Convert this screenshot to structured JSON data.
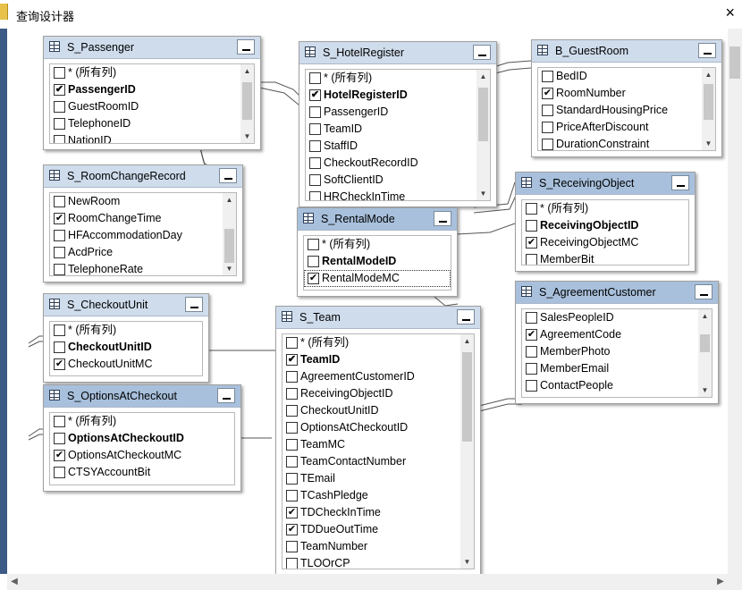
{
  "window": {
    "title": "查询设计器",
    "close_label": "×"
  },
  "tables": [
    {
      "id": "passenger",
      "title": "S_Passenger",
      "columns": [
        {
          "name": "* (所有列)",
          "checked": false,
          "pk": false
        },
        {
          "name": "PassengerID",
          "checked": true,
          "pk": true
        },
        {
          "name": "GuestRoomID",
          "checked": false,
          "pk": false
        },
        {
          "name": "TelephoneID",
          "checked": false,
          "pk": false
        },
        {
          "name": "NationID",
          "checked": false,
          "pk": false
        }
      ]
    },
    {
      "id": "hotelregister",
      "title": "S_HotelRegister",
      "columns": [
        {
          "name": "* (所有列)",
          "checked": false,
          "pk": false
        },
        {
          "name": "HotelRegisterID",
          "checked": true,
          "pk": true
        },
        {
          "name": "PassengerID",
          "checked": false,
          "pk": false
        },
        {
          "name": "TeamID",
          "checked": false,
          "pk": false
        },
        {
          "name": "StaffID",
          "checked": false,
          "pk": false
        },
        {
          "name": "CheckoutRecordID",
          "checked": false,
          "pk": false
        },
        {
          "name": "SoftClientID",
          "checked": false,
          "pk": false
        },
        {
          "name": "HRCheckInTime",
          "checked": false,
          "pk": false
        }
      ]
    },
    {
      "id": "guestroom",
      "title": "B_GuestRoom",
      "columns": [
        {
          "name": "BedID",
          "checked": false,
          "pk": false
        },
        {
          "name": "RoomNumber",
          "checked": true,
          "pk": false
        },
        {
          "name": "StandardHousingPrice",
          "checked": false,
          "pk": false
        },
        {
          "name": "PriceAfterDiscount",
          "checked": false,
          "pk": false
        },
        {
          "name": "DurationConstraint",
          "checked": false,
          "pk": false
        }
      ]
    },
    {
      "id": "roomchange",
      "title": "S_RoomChangeRecord",
      "columns": [
        {
          "name": "NewRoom",
          "checked": false,
          "pk": false
        },
        {
          "name": "RoomChangeTime",
          "checked": true,
          "pk": false
        },
        {
          "name": "HFAccommodationDay",
          "checked": false,
          "pk": false
        },
        {
          "name": "AcdPrice",
          "checked": false,
          "pk": false
        },
        {
          "name": "TelephoneRate",
          "checked": false,
          "pk": false
        }
      ]
    },
    {
      "id": "receiving",
      "title": "S_ReceivingObject",
      "columns": [
        {
          "name": "* (所有列)",
          "checked": false,
          "pk": false
        },
        {
          "name": "ReceivingObjectID",
          "checked": false,
          "pk": true
        },
        {
          "name": "ReceivingObjectMC",
          "checked": true,
          "pk": false
        },
        {
          "name": "MemberBit",
          "checked": false,
          "pk": false
        }
      ]
    },
    {
      "id": "rentalmode",
      "title": "S_RentalMode",
      "columns": [
        {
          "name": "* (所有列)",
          "checked": false,
          "pk": false
        },
        {
          "name": "RentalModeID",
          "checked": false,
          "pk": true
        },
        {
          "name": "RentalModeMC",
          "checked": true,
          "pk": false,
          "selected": true
        }
      ]
    },
    {
      "id": "agreement",
      "title": "S_AgreementCustomer",
      "columns": [
        {
          "name": "SalesPeopleID",
          "checked": false,
          "pk": false
        },
        {
          "name": "AgreementCode",
          "checked": true,
          "pk": false
        },
        {
          "name": "MemberPhoto",
          "checked": false,
          "pk": false
        },
        {
          "name": "MemberEmail",
          "checked": false,
          "pk": false
        },
        {
          "name": "ContactPeople",
          "checked": false,
          "pk": false
        }
      ]
    },
    {
      "id": "checkoutunit",
      "title": "S_CheckoutUnit",
      "columns": [
        {
          "name": "* (所有列)",
          "checked": false,
          "pk": false
        },
        {
          "name": "CheckoutUnitID",
          "checked": false,
          "pk": true
        },
        {
          "name": "CheckoutUnitMC",
          "checked": true,
          "pk": false
        }
      ]
    },
    {
      "id": "team",
      "title": "S_Team",
      "columns": [
        {
          "name": "* (所有列)",
          "checked": false,
          "pk": false
        },
        {
          "name": "TeamID",
          "checked": true,
          "pk": true
        },
        {
          "name": "AgreementCustomerID",
          "checked": false,
          "pk": false
        },
        {
          "name": "ReceivingObjectID",
          "checked": false,
          "pk": false
        },
        {
          "name": "CheckoutUnitID",
          "checked": false,
          "pk": false
        },
        {
          "name": "OptionsAtCheckoutID",
          "checked": false,
          "pk": false
        },
        {
          "name": "TeamMC",
          "checked": false,
          "pk": false
        },
        {
          "name": "TeamContactNumber",
          "checked": false,
          "pk": false
        },
        {
          "name": "TEmail",
          "checked": false,
          "pk": false
        },
        {
          "name": "TCashPledge",
          "checked": false,
          "pk": false
        },
        {
          "name": "TDCheckInTime",
          "checked": true,
          "pk": false
        },
        {
          "name": "TDDueOutTime",
          "checked": true,
          "pk": false
        },
        {
          "name": "TeamNumber",
          "checked": false,
          "pk": false
        },
        {
          "name": "TLOOrCP",
          "checked": false,
          "pk": false
        }
      ]
    },
    {
      "id": "options",
      "title": "S_OptionsAtCheckout",
      "columns": [
        {
          "name": "* (所有列)",
          "checked": false,
          "pk": false
        },
        {
          "name": "OptionsAtCheckoutID",
          "checked": false,
          "pk": true
        },
        {
          "name": "OptionsAtCheckoutMC",
          "checked": true,
          "pk": false
        },
        {
          "name": "CTSYAccountBit",
          "checked": false,
          "pk": false
        }
      ]
    }
  ]
}
